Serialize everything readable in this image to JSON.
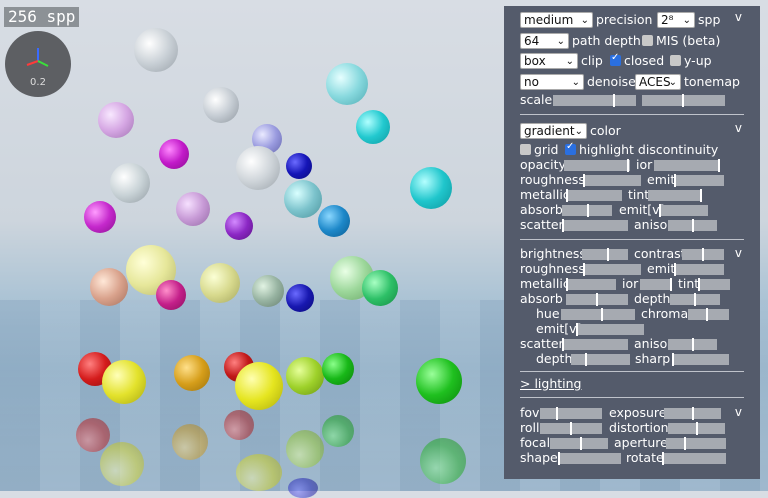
{
  "viewport": {
    "spp_label": "256 spp",
    "gizmo_value": "0.2"
  },
  "panel": {
    "render": {
      "precision_value": "medium",
      "precision_label": "precision",
      "spp_value": "2⁸",
      "spp_label": "spp",
      "depth_value": "64",
      "depth_label": "path depth",
      "mis_label": "MIS (beta)",
      "mis_checked": false,
      "clip_value": "box",
      "clip_label": "clip",
      "closed_label": "closed",
      "closed_checked": true,
      "yup_label": "y-up",
      "yup_checked": false,
      "denoise_value": "no",
      "denoise_label": "denoise",
      "tonemap_value": "ACES",
      "tonemap_label": "tonemap",
      "scale_label": "scale",
      "scale_values": [
        0.8,
        0.55
      ]
    },
    "material": {
      "color_mode_value": "gradient",
      "color_label": "color",
      "grid_label": "grid",
      "grid_checked": false,
      "highlight_label": "highlight discontinuity",
      "highlight_checked": true,
      "opacity_label": "opacity",
      "ior_label": "ior",
      "roughness_label": "roughness",
      "emit_label": "emit",
      "metallic_label": "metallic",
      "tint_label": "tint",
      "absorb_label": "absorb",
      "emitv_label": "emit[v]",
      "scatter_label": "scatter",
      "aniso_label": "aniso"
    },
    "adjust": {
      "brightness_label": "brightness",
      "contrast_label": "contrast",
      "roughness_label": "roughness",
      "emit_label": "emit",
      "metallic_label": "metallic",
      "ior_label": "ior",
      "tint_label": "tint",
      "absorb_label": "absorb",
      "depth_label": "depth",
      "hue_label": "hue",
      "chroma_label": "chroma",
      "emitv_label": "emit[v]",
      "scatter_label": "scatter",
      "aniso_label": "aniso",
      "depth2_label": "depth",
      "sharp_label": "sharp"
    },
    "lighting_link": "> lighting",
    "camera": {
      "fov_label": "fov",
      "exposure_label": "exposure",
      "roll_label": "roll",
      "distortion_label": "distortion",
      "focal_label": "focal",
      "aperture_label": "aperture",
      "shape_label": "shape",
      "rotate_label": "rotate"
    },
    "chevron": "v"
  },
  "colors": {
    "panel_bg": "#545b6b",
    "checkbox_on": "#2a6fe0",
    "slider_track": "#a6aab1"
  }
}
